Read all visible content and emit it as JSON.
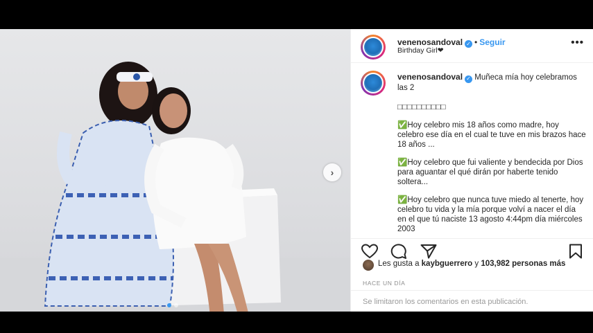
{
  "post": {
    "username": "venenosandoval",
    "follow_label": "Seguir",
    "separator": "•",
    "location": "Birthday Girl❤",
    "more_label": "•••",
    "next_arrow": "›",
    "caption": {
      "username": "venenosandoval",
      "line1": "Muñeca mía hoy celebramos las 2",
      "emoji_row": "□□□□□□□□□□",
      "p1": "✅Hoy celebro mis 18 años como madre, hoy celebro ese día en el cual te tuve en mis brazos hace 18 años ...",
      "p2": "✅Hoy celebro que fui valiente y bendecida por Dios para aguantar el qué dirán por haberte tenido soltera...",
      "p3": "✅Hoy celebro que nunca tuve miedo al tenerte, hoy celebro tu vida y la mía porque volví a nacer el día en el que tú naciste 13 agosto 4:44pm día miércoles 2003"
    },
    "likes": {
      "prefix": "Les gusta a ",
      "user": "kaybguerrero",
      "mid": " y",
      "count": "103,982 personas más"
    },
    "time_label": "HACE UN DÍA",
    "comments_disabled": "Se limitaron los comentarios en esta publicación.",
    "carousel": {
      "slides": 2,
      "active": 0
    }
  },
  "icons": [
    "verified-badge-icon",
    "more-options-icon",
    "next-arrow-icon",
    "heart-icon",
    "comment-icon",
    "share-icon",
    "bookmark-icon"
  ],
  "colors": {
    "accent": "#3897f0",
    "text": "#262626",
    "muted": "#8e8e8e"
  }
}
